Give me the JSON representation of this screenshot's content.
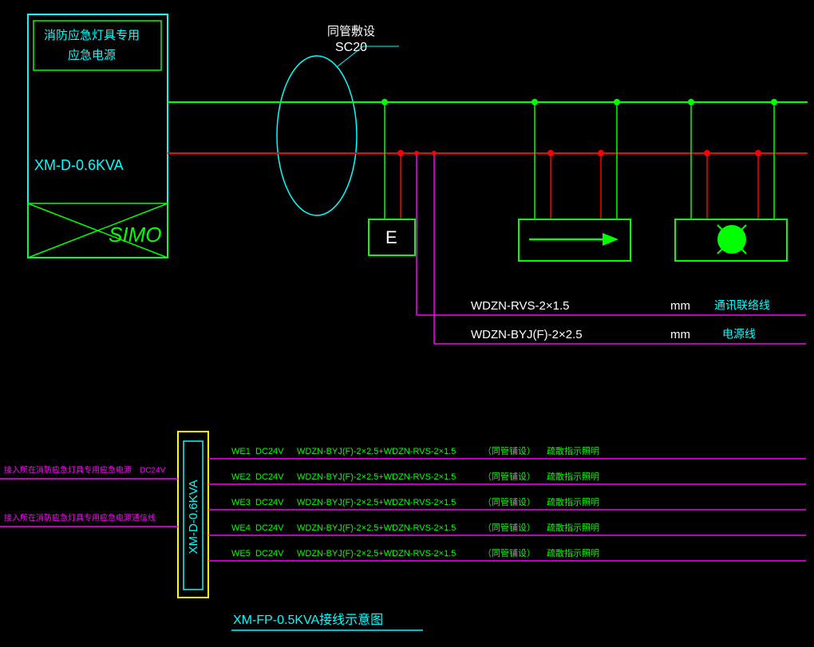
{
  "top": {
    "box_label1": "消防应急灯具专用",
    "box_label2": "应急电源",
    "model": "XM-D-0.6KVA",
    "simo": "SIMO",
    "conduit_top": "同管敷设",
    "conduit_bottom": "SC20",
    "symbol_e": "E",
    "cable1_spec": "WDZN-RVS-2×1.5",
    "cable1_unit": "mm",
    "cable1_name": "通讯联络线",
    "cable2_spec": "WDZN-BYJ(F)-2×2.5",
    "cable2_unit": "mm",
    "cable2_name": "电源线"
  },
  "bottom": {
    "box_model": "XM-D-0.6KVA",
    "title": "XM-FP-0.5KVA接线示意图",
    "left_note1": "接入所在消防应急灯具专用应急电源",
    "left_note1_v": "DC24V",
    "left_note2": "接入所在消防应急灯具专用应急电源通信线",
    "rows": [
      {
        "id": "WE1",
        "v": "DC24V",
        "spec": "WDZN-BYJ(F)-2×2.5+WDZN-RVS-2×1.5",
        "note1": "（同管铺设）",
        "note2": "疏散指示照明"
      },
      {
        "id": "WE2",
        "v": "DC24V",
        "spec": "WDZN-BYJ(F)-2×2.5+WDZN-RVS-2×1.5",
        "note1": "（同管铺设）",
        "note2": "疏散指示照明"
      },
      {
        "id": "WE3",
        "v": "DC24V",
        "spec": "WDZN-BYJ(F)-2×2.5+WDZN-RVS-2×1.5",
        "note1": "（同管铺设）",
        "note2": "疏散指示照明"
      },
      {
        "id": "WE4",
        "v": "DC24V",
        "spec": "WDZN-BYJ(F)-2×2.5+WDZN-RVS-2×1.5",
        "note1": "（同管铺设）",
        "note2": "疏散指示照明"
      },
      {
        "id": "WE5",
        "v": "DC24V",
        "spec": "WDZN-BYJ(F)-2×2.5+WDZN-RVS-2×1.5",
        "note1": "（同管铺设）",
        "note2": "疏散指示照明"
      }
    ]
  }
}
